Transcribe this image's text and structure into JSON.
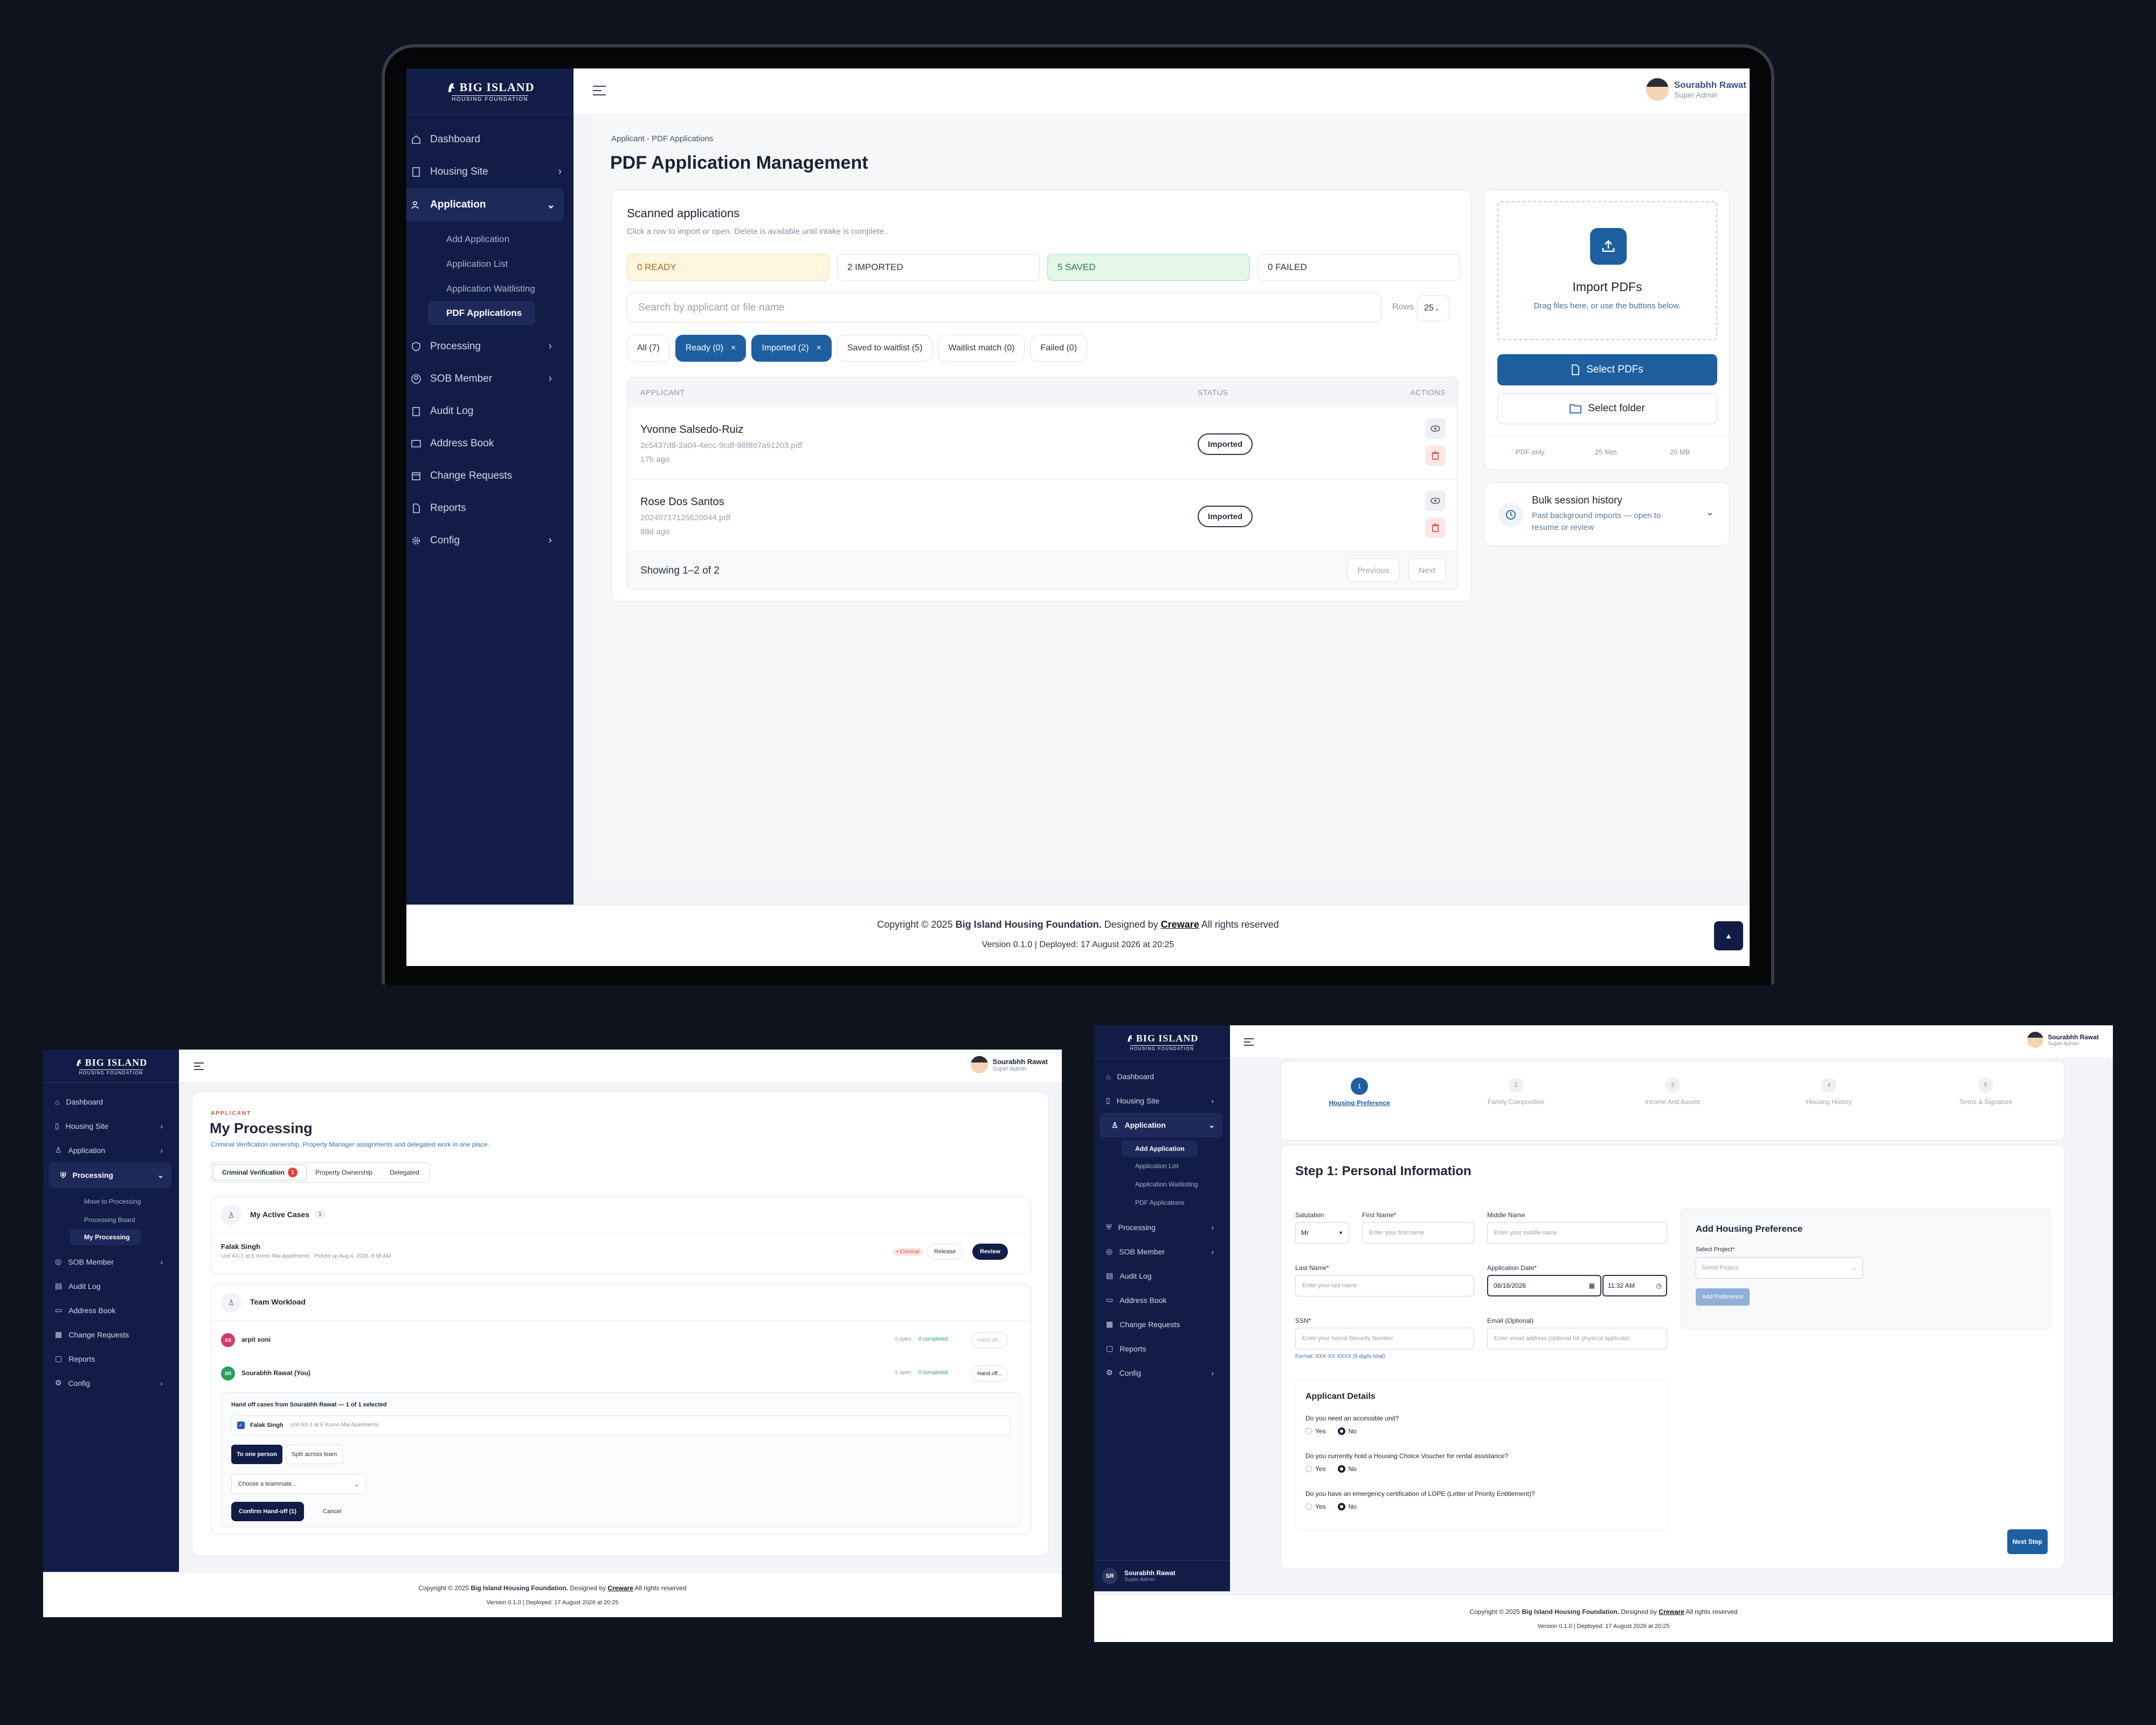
{
  "brand": {
    "name": "BIG ISLAND",
    "sub": "HOUSING FOUNDATION"
  },
  "user": {
    "name": "Sourabhh Rawat",
    "role": "Super Admin",
    "initials": "SR",
    "you": "Sourabhh Rawat (You)"
  },
  "footer": {
    "prefix": "Copyright © 2025 ",
    "org": "Big Island Housing Foundation.",
    "designed": " Designed by ",
    "designer": "Creware",
    "suffix": " All rights reserved",
    "version": "Version 0.1.0 | Deployed: 17 August 2026 at 20:25"
  },
  "nav": {
    "dashboard": "Dashboard",
    "housing_site": "Housing Site",
    "application": "Application",
    "processing": "Processing",
    "sob_member": "SOB Member",
    "audit_log": "Audit Log",
    "address_book": "Address Book",
    "change_requests": "Change Requests",
    "reports": "Reports",
    "config": "Config",
    "app_sub": [
      "Add Application",
      "Application List",
      "Application Waitlisting",
      "PDF Applications"
    ],
    "proc_sub": [
      "Move to Processing",
      "Processing Board",
      "My Processing"
    ]
  },
  "colors": {
    "navy": "#111c47",
    "accent": "#1e5fa0",
    "ready": "#fff6df",
    "saved": "#e3f6e8"
  },
  "pdf": {
    "breadcrumb": "Applicant - PDF Applications",
    "title": "PDF Application Management",
    "scanned_title": "Scanned applications",
    "scanned_hint": "Click a row to import or open. Delete is available until intake is complete.",
    "stats": [
      "0 READY",
      "2 IMPORTED",
      "5 SAVED",
      "0 FAILED"
    ],
    "search_placeholder": "Search by applicant or file name",
    "rows_label": "Rows",
    "rows_value": "25",
    "filters": [
      "All (7)",
      "Ready (0)",
      "Imported (2)",
      "Saved to waitlist (5)",
      "Waitlist match (0)",
      "Failed (0)"
    ],
    "columns": [
      "APPLICANT",
      "STATUS",
      "ACTIONS"
    ],
    "rows": [
      {
        "name": "Yvonne Salsedo-Ruiz",
        "file": "2c5437d8-2a04-4ecc-9cdf-98f867a91203.pdf",
        "ago": "17h ago",
        "status": "Imported"
      },
      {
        "name": "Rose Dos Santos",
        "file": "20240717125620044.pdf",
        "ago": "88d ago",
        "status": "Imported"
      }
    ],
    "showing": "Showing 1–2 of 2",
    "prev": "Previous",
    "next": "Next",
    "import_title": "Import PDFs",
    "import_hint": "Drag files here, or use the buttons below.",
    "select_pdfs": "Select PDFs",
    "select_folder": "Select folder",
    "limits": [
      "PDF only",
      "25 files",
      "20 MB"
    ],
    "bulk_title": "Bulk session history",
    "bulk_hint": "Past background imports — open to resume or review"
  },
  "proc": {
    "kicker": "APPLICANT",
    "title": "My Processing",
    "subtitle": "Criminal Verification ownership, Property Manager assignments and delegated work in one place.",
    "tabs": [
      "Criminal Verification",
      "Property Ownership",
      "Delegated"
    ],
    "tab_count": "1",
    "active_title": "My Active Cases",
    "active_count": "1",
    "case_name": "Falak Singh",
    "case_meta": "Unit AS-1 at E Komo Mai Apartments · Picked up Aug 4, 2026, 8:58 AM",
    "case_tag": "• Criminal",
    "release": "Release",
    "review": "Review",
    "team_title": "Team Workload",
    "members": [
      {
        "initials": "AS",
        "name": "arpit soni",
        "open": "0 open",
        "done": "0 completed",
        "action": "Hand off..."
      },
      {
        "initials": "SR",
        "name": "Sourabhh Rawat (You)",
        "open": "1 open",
        "done": "0 completed",
        "action": "Hand off..."
      }
    ],
    "handoff_title": "Hand off cases from Sourabhh Rawat — 1 of 1 selected",
    "handoff_case": "Falak Singh",
    "handoff_unit": "Unit AS-1 at E Komo Mai Apartments",
    "mode": [
      "To one person",
      "Split across team"
    ],
    "teammate_placeholder": "Choose a teammate...",
    "confirm": "Confirm Hand-off (1)",
    "cancel": "Cancel"
  },
  "form": {
    "steps": [
      "Housing Preference",
      "Family Composition",
      "Income And Assets",
      "Housing History",
      "Terms & Signature"
    ],
    "step_title": "Step 1: Personal Information",
    "labels": {
      "salutation": "Salutation",
      "first": "First Name*",
      "middle": "Middle Name",
      "last": "Last Name*",
      "app_date": "Application Date*",
      "ssn": "SSN*",
      "email": "Email (Optional)"
    },
    "salutation_value": "Mr",
    "ph": {
      "first": "Enter your first name",
      "middle": "Enter your middle name",
      "last": "Enter your last name",
      "ssn": "Enter your Social Security Number",
      "email": "Enter email address (optional for physical applicatio"
    },
    "date_value": "08/18/2026",
    "time_value": "11:32 AM",
    "ssn_hint": "Format: XXX-XX-XXXX (9 digits total)",
    "pref_title": "Add Housing Preference",
    "project_label": "Select Project*",
    "project_ph": "Select Project",
    "add_pref": "Add Preference",
    "details_title": "Applicant Details",
    "questions": [
      "Do you need an accessible unit?",
      "Do you currently hold a Housing Choice Voucher for rental assistance?",
      "Do you have an emergency certification of LOPE (Letter of Priority Entitlement)?"
    ],
    "yes": "Yes",
    "no": "No",
    "next_step": "Next Step"
  }
}
